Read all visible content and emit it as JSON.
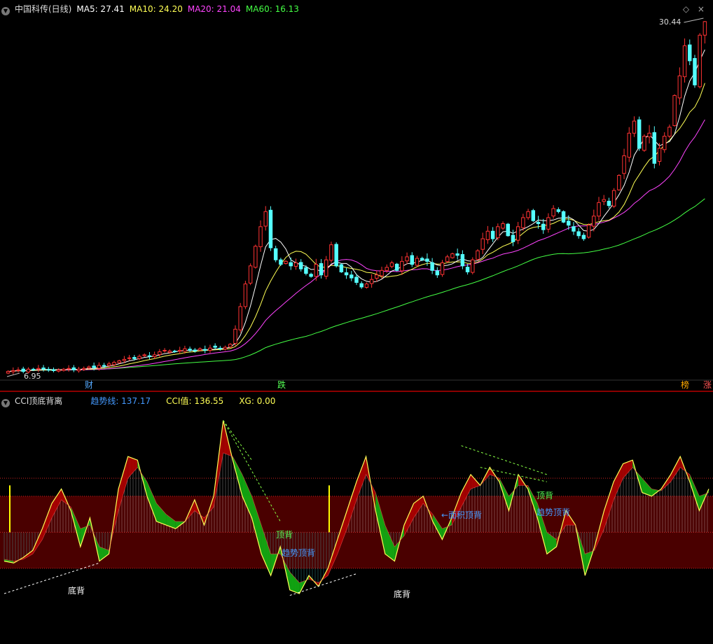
{
  "main": {
    "title": "中国科传(日线)",
    "ma_labels": [
      {
        "text": "MA5: 27.41",
        "color": "#ffffff"
      },
      {
        "text": "MA10: 24.20",
        "color": "#ffff55"
      },
      {
        "text": "MA20: 21.04",
        "color": "#ff44ff"
      },
      {
        "text": "MA60: 16.13",
        "color": "#44ff44"
      }
    ],
    "high_label": "30.44",
    "low_label": "6.95",
    "markers": [
      {
        "text": "财",
        "color": "#55aaff"
      },
      {
        "text": "跌",
        "color": "#55ff55"
      },
      {
        "text": "榜",
        "color": "#ffaa00"
      },
      {
        "text": "涨",
        "color": "#ff5555"
      }
    ],
    "ctrl_icons": "◇ ×"
  },
  "indicator": {
    "title": "CCI顶底背离",
    "values": [
      {
        "text": "趋势线: 137.17",
        "color": "#4499ff"
      },
      {
        "text": "CCI值: 136.55",
        "color": "#ffff55"
      },
      {
        "text": "XG: 0.00",
        "color": "#ffff55"
      }
    ],
    "annotations": [
      {
        "text": "底背",
        "color": "#ffffff"
      },
      {
        "text": "顶背",
        "color": "#55ff55"
      },
      {
        "text": "趋势顶背",
        "color": "#4499ff"
      },
      {
        "text": "底背",
        "color": "#ffffff"
      },
      {
        "text": "←面积顶背",
        "color": "#4499ff"
      },
      {
        "text": "顶背",
        "color": "#55ff55"
      },
      {
        "text": "趋势顶背",
        "color": "#4499ff"
      }
    ]
  },
  "chart_data": [
    {
      "type": "candlestick",
      "title": "中国科传(日线)",
      "price_range": [
        6.95,
        30.44
      ],
      "colors": {
        "up": "#ff3333",
        "down": "#55ffff",
        "ma5": "#ffffff",
        "ma10": "#ffff55",
        "ma20": "#ff44ff",
        "ma60": "#44ff44"
      },
      "close": [
        7.2,
        7.25,
        7.3,
        7.2,
        7.35,
        7.3,
        7.4,
        7.35,
        7.3,
        7.25,
        7.3,
        7.35,
        7.4,
        7.3,
        7.35,
        7.4,
        7.5,
        7.45,
        7.6,
        7.55,
        7.7,
        7.8,
        7.9,
        8.0,
        8.1,
        8.05,
        8.2,
        8.3,
        8.2,
        8.3,
        8.5,
        8.6,
        8.55,
        8.5,
        8.6,
        8.7,
        8.6,
        8.55,
        8.7,
        8.6,
        8.75,
        8.8,
        8.7,
        8.8,
        9.0,
        10.0,
        11.5,
        13.0,
        14.2,
        15.5,
        16.8,
        17.8,
        15.4,
        14.6,
        14.3,
        14.5,
        14.2,
        14.4,
        14.0,
        13.7,
        13.5,
        14.3,
        13.6,
        14.6,
        15.6,
        14.2,
        13.8,
        13.6,
        13.4,
        13.1,
        12.8,
        13.0,
        13.3,
        13.6,
        13.9,
        14.1,
        14.4,
        13.9,
        14.5,
        14.8,
        14.3,
        14.7,
        14.6,
        14.5,
        13.9,
        13.6,
        14.4,
        14.8,
        15.0,
        14.9,
        14.2,
        13.8,
        14.6,
        15.2,
        16.0,
        16.5,
        16.0,
        16.8,
        17.0,
        16.2,
        15.8,
        16.8,
        17.4,
        17.8,
        17.2,
        17.0,
        16.6,
        17.4,
        18.0,
        17.8,
        17.1,
        16.9,
        16.5,
        16.2,
        16.0,
        16.9,
        17.5,
        18.4,
        18.6,
        18.2,
        19.2,
        20.2,
        21.5,
        23.0,
        23.8,
        22.0,
        22.8,
        23.0,
        21.0,
        22.0,
        22.8,
        23.4,
        25.5,
        26.8,
        28.8,
        27.8,
        26.2,
        29.5,
        30.4
      ],
      "ma_latest": {
        "MA5": 27.41,
        "MA10": 24.2,
        "MA20": 21.04,
        "MA60": 16.13
      }
    },
    {
      "type": "line",
      "title": "CCI顶底背离",
      "ylim": [
        -300,
        350
      ],
      "series": [
        {
          "name": "CCI值",
          "color": "#ffff55",
          "values": [
            -80,
            -85,
            -70,
            -50,
            10,
            80,
            120,
            60,
            -40,
            40,
            -80,
            -60,
            120,
            210,
            200,
            100,
            30,
            20,
            10,
            30,
            90,
            20,
            100,
            310,
            200,
            100,
            40,
            -60,
            -120,
            -40,
            -160,
            -170,
            -120,
            -150,
            -100,
            -20,
            60,
            140,
            210,
            60,
            -60,
            -80,
            20,
            80,
            100,
            30,
            -20,
            40,
            110,
            160,
            130,
            180,
            140,
            60,
            160,
            120,
            40,
            -60,
            -40,
            60,
            20,
            -120,
            -40,
            60,
            140,
            190,
            200,
            110,
            100,
            120,
            160,
            210,
            140,
            60,
            120
          ]
        },
        {
          "name": "趋势线",
          "color": "#4499ff",
          "values": [
            -75,
            -80,
            -75,
            -60,
            -20,
            40,
            90,
            70,
            10,
            20,
            -40,
            -50,
            60,
            150,
            180,
            140,
            80,
            50,
            30,
            30,
            60,
            40,
            70,
            220,
            210,
            160,
            100,
            20,
            -60,
            -60,
            -110,
            -140,
            -130,
            -140,
            -120,
            -60,
            10,
            90,
            160,
            110,
            20,
            -40,
            -10,
            40,
            80,
            50,
            10,
            20,
            70,
            120,
            130,
            160,
            150,
            100,
            130,
            130,
            80,
            0,
            -20,
            20,
            20,
            -60,
            -50,
            10,
            90,
            150,
            180,
            150,
            120,
            115,
            140,
            180,
            160,
            100,
            110
          ]
        }
      ],
      "value_latest": {
        "趋势线": 137.17,
        "CCI值": 136.55,
        "XG": 0.0
      }
    }
  ]
}
